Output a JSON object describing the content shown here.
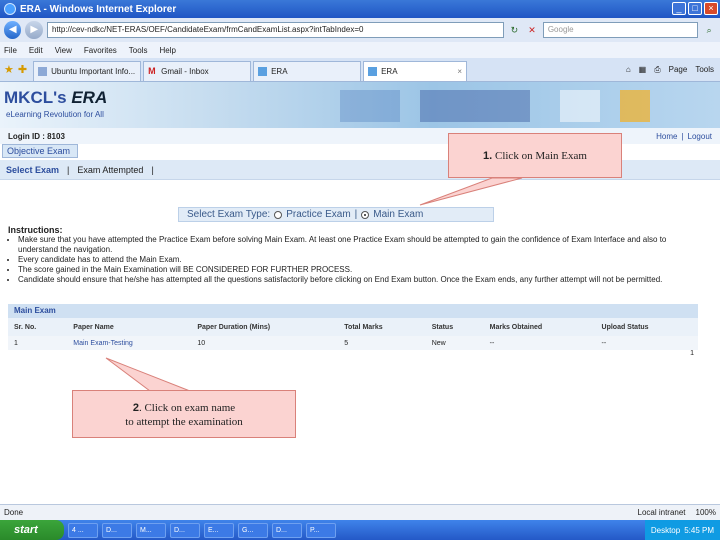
{
  "window": {
    "title": "ERA - Windows Internet Explorer",
    "min": "_",
    "max": "□",
    "close": "×"
  },
  "address_bar": {
    "back": "◀",
    "forward": "▶",
    "url": "http://cev-ndkc/NET-ERAS/OEF/CandidateExam/frmCandExamList.aspx?intTabIndex=0",
    "refresh": "↻",
    "stop": "✕",
    "search_placeholder": "Google"
  },
  "menu": [
    "File",
    "Edit",
    "View",
    "Favorites",
    "Tools",
    "Help"
  ],
  "tabs": [
    {
      "label": "Ubuntu Important Info..."
    },
    {
      "label": "Gmail - Inbox"
    },
    {
      "label": "ERA"
    },
    {
      "label": "ERA",
      "close": "×"
    }
  ],
  "toolbar": {
    "page": "Page",
    "tools": "Tools"
  },
  "banner": {
    "logo_mkcl": "MKCL's",
    "logo_era": "ERA",
    "tagline": "eLearning Revolution for All"
  },
  "login": {
    "label": "Login ID : 8103",
    "home": "Home",
    "sep": "|",
    "logout": "Logout"
  },
  "nav": {
    "objective_exam": "Objective Exam",
    "select_exam": "Select Exam",
    "sep": "|",
    "exam_attempted": "Exam Attempted",
    "sep2": "|"
  },
  "exam_type": {
    "label": "Select Exam Type:",
    "practice": "Practice Exam",
    "sep": "|",
    "main": "Main Exam"
  },
  "instructions": {
    "heading": "Instructions:",
    "items": [
      "Make sure that you have attempted the Practice Exam before solving Main Exam. At least one Practice Exam should be attempted to gain the confidence of Exam Interface and also to understand the navigation.",
      "Every candidate has to attend the Main Exam.",
      "The score gained in the Main Examination will BE CONSIDERED FOR FURTHER PROCESS.",
      "Candidate should ensure that he/she has attempted all the questions satisfactorily before clicking on End Exam button. Once the Exam ends, any further attempt will not be permitted."
    ]
  },
  "main_exam": {
    "title": "Main Exam",
    "columns": [
      "Sr. No.",
      "Paper Name",
      "Paper Duration (Mins)",
      "Total Marks",
      "Status",
      "Marks Obtained",
      "Upload Status"
    ],
    "rows": [
      [
        "1",
        "Main Exam-Testing",
        "10",
        "5",
        "New",
        "--",
        "--"
      ]
    ],
    "page": "1"
  },
  "callouts": {
    "one_num": "1.",
    "one_text": " Click on Main Exam",
    "two_num": "2",
    "two_text_a": ". Click on exam name",
    "two_text_b": "to attempt  the examination"
  },
  "status_bar": {
    "left": "Done",
    "zone": "Local intranet",
    "zoom": "100%"
  },
  "taskbar": {
    "start": "start",
    "tasks": [
      "4 ...",
      "D...",
      "M...",
      "D...",
      "E...",
      "G...",
      "D...",
      "P..."
    ],
    "desktop": "Desktop",
    "clock": "5:45 PM"
  }
}
